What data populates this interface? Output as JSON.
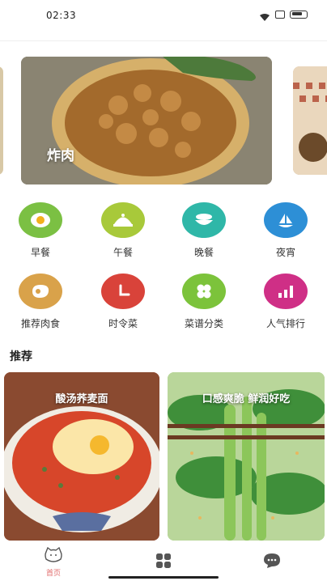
{
  "status_bar": {
    "time": "02:33"
  },
  "banner": {
    "title": "炸肉"
  },
  "categories": [
    {
      "label": "早餐",
      "icon": "fried-egg-icon",
      "color": "#7bc043"
    },
    {
      "label": "午餐",
      "icon": "food-cloche-icon",
      "color": "#a8c93a"
    },
    {
      "label": "晚餐",
      "icon": "dinner-bowl-icon",
      "color": "#2fb7a8"
    },
    {
      "label": "夜宵",
      "icon": "moon-ship-icon",
      "color": "#2d8fd6"
    },
    {
      "label": "推荐肉食",
      "icon": "meat-steak-icon",
      "color": "#d9a24a"
    },
    {
      "label": "时令菜",
      "icon": "clock-icon",
      "color": "#d9433a"
    },
    {
      "label": "菜谱分类",
      "icon": "four-leaf-icon",
      "color": "#7cc33b"
    },
    {
      "label": "人气排行",
      "icon": "ranking-bars-icon",
      "color": "#cf2f86"
    }
  ],
  "recommend": {
    "section_title": "推荐",
    "cards": [
      {
        "title": "酸汤荞麦面"
      },
      {
        "title": "口感爽脆 鲜润好吃"
      }
    ]
  },
  "bottom_nav": {
    "items": [
      {
        "label": "首页",
        "icon": "cat-face-icon",
        "active": true
      },
      {
        "label": "",
        "icon": "grid-icon",
        "active": false
      },
      {
        "label": "",
        "icon": "chat-bubble-icon",
        "active": false
      }
    ],
    "active_color": "#e06a6a"
  }
}
